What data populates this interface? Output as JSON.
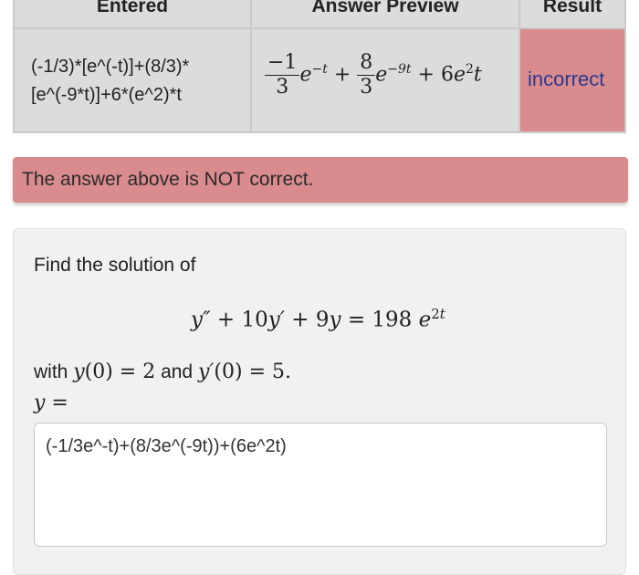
{
  "table": {
    "headers": [
      "Entered",
      "Answer Preview",
      "Result"
    ],
    "entered_line1": "(-1/3)*[e^(-t)]+(8/3)*",
    "entered_line2": "[e^(-9*t)]+6*(e^2)*t",
    "result": "incorrect",
    "colors": {
      "result_bg": "#d98b8d",
      "result_text": "#2a3a8f"
    }
  },
  "alert": {
    "text": "The answer above is NOT correct.",
    "color": "#d98b8d"
  },
  "problem": {
    "intro": "Find the solution of",
    "with_word": "with",
    "and_word": "and",
    "answer_value": "(-1/3e^-t)+(8/3e^(-9t))+(6e^2t)"
  }
}
